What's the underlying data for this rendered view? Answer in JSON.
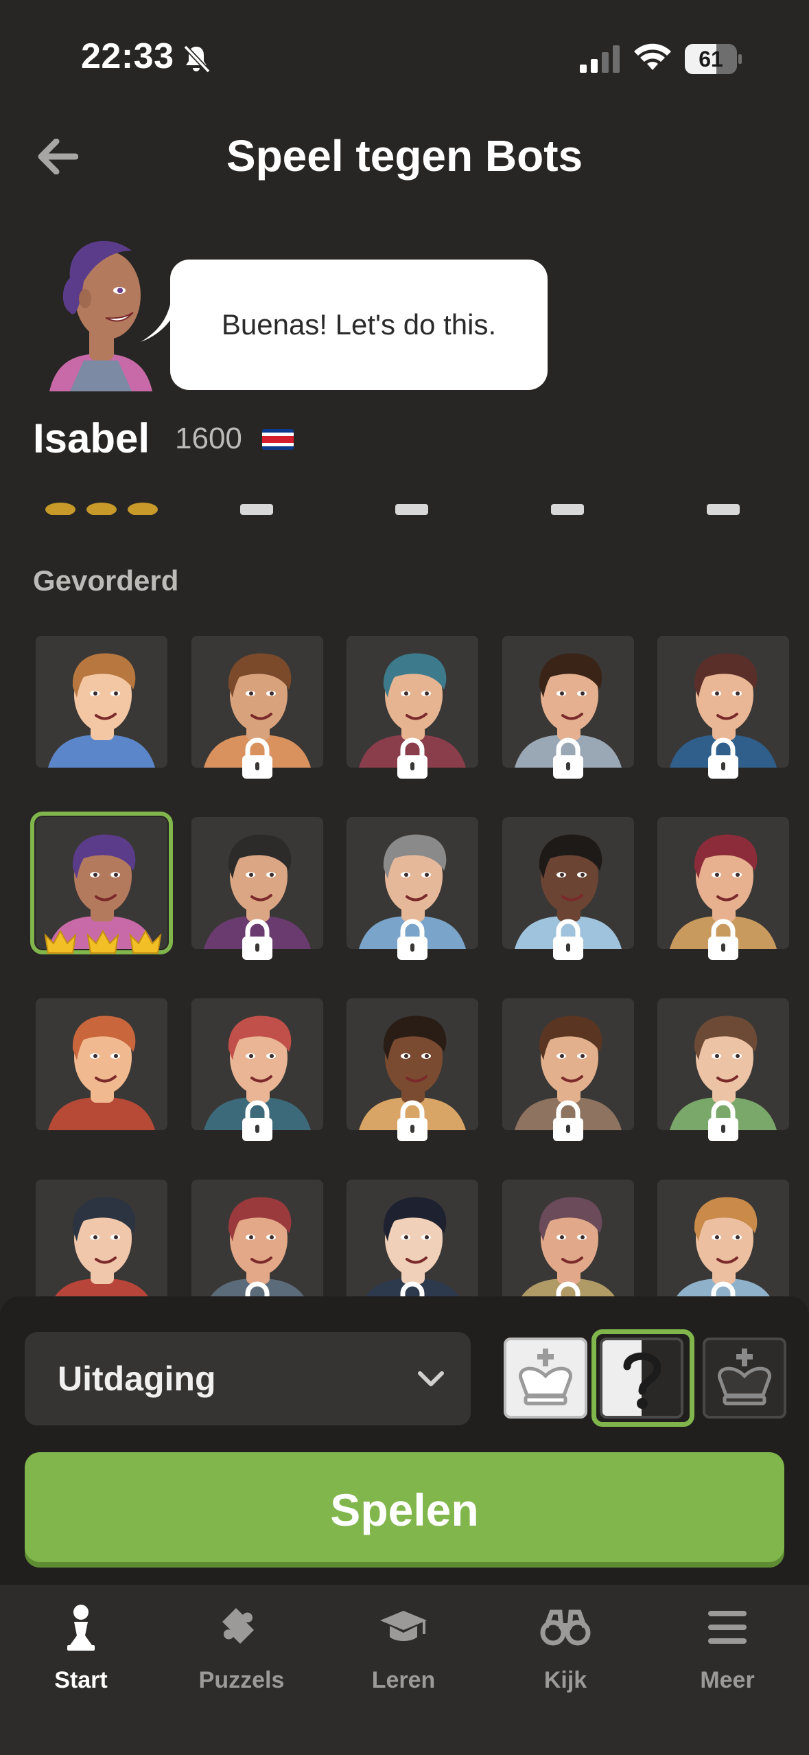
{
  "status_bar": {
    "time": "22:33",
    "battery": "61",
    "battery_level": 0.61
  },
  "header": {
    "title": "Speel tegen Bots"
  },
  "bot": {
    "greeting": "Buenas! Let's do this.",
    "name": "Isabel",
    "rating": "1600",
    "country_flag": "costa-rica-flag"
  },
  "section": {
    "title": "Gevorderd"
  },
  "bots_grid": [
    [
      {
        "locked": false,
        "skin": "#f3c7a4",
        "hair": "#b8773f",
        "shirt": "#5b86c9"
      },
      {
        "locked": true,
        "skin": "#d8a27c",
        "hair": "#7a4a2b",
        "shirt": "#d9925e"
      },
      {
        "locked": true,
        "skin": "#e6b491",
        "hair": "#3d7a8c",
        "shirt": "#8a3e4c"
      },
      {
        "locked": true,
        "skin": "#e4b08f",
        "hair": "#3a2418",
        "shirt": "#9aa7b5"
      },
      {
        "locked": true,
        "skin": "#eab796",
        "hair": "#5a2f2a",
        "shirt": "#2f5f8a"
      }
    ],
    [
      {
        "locked": false,
        "selected": true,
        "skin": "#b47a5e",
        "hair": "#5b3c8a",
        "shirt": "#c96aa8"
      },
      {
        "locked": true,
        "skin": "#dba683",
        "hair": "#2d2a2a",
        "shirt": "#6a3b6f"
      },
      {
        "locked": true,
        "skin": "#e5b89a",
        "hair": "#8a8a8a",
        "shirt": "#7aa4c9"
      },
      {
        "locked": true,
        "skin": "#6b4433",
        "hair": "#1e1a18",
        "shirt": "#9fc3dd"
      },
      {
        "locked": true,
        "skin": "#e7b08f",
        "hair": "#8c2c3a",
        "shirt": "#c99a5e"
      }
    ],
    [
      {
        "locked": false,
        "skin": "#f0b98f",
        "hair": "#c9663c",
        "shirt": "#b64a36"
      },
      {
        "locked": true,
        "skin": "#e9b595",
        "hair": "#c2504a",
        "shirt": "#3d6a7a"
      },
      {
        "locked": true,
        "skin": "#7a4b31",
        "hair": "#2a1d16",
        "shirt": "#d8a566"
      },
      {
        "locked": true,
        "skin": "#e2b08d",
        "hair": "#5a3522",
        "shirt": "#8e7460"
      },
      {
        "locked": true,
        "skin": "#ecc3a5",
        "hair": "#6c4a36",
        "shirt": "#7aa86a"
      }
    ],
    [
      {
        "locked": false,
        "skin": "#f1c7ab",
        "hair": "#2b3440",
        "shirt": "#b8453a"
      },
      {
        "locked": true,
        "skin": "#e3a888",
        "hair": "#9a3a3c",
        "shirt": "#5c6b7a"
      },
      {
        "locked": true,
        "skin": "#f0d0b8",
        "hair": "#1e2230",
        "shirt": "#2d3a4d"
      },
      {
        "locked": true,
        "skin": "#e1a98a",
        "hair": "#6b4a5a",
        "shirt": "#b09a66"
      },
      {
        "locked": true,
        "skin": "#ebbf9f",
        "hair": "#c98a4a",
        "shirt": "#8fb1c9"
      }
    ]
  ],
  "controls": {
    "mode": "Uitdaging",
    "colors": [
      "white-king-icon",
      "random-color-icon",
      "black-king-icon"
    ],
    "selected_color": "random",
    "play": "Spelen"
  },
  "tabs": [
    {
      "label": "Start",
      "icon": "pawn-icon",
      "active": true
    },
    {
      "label": "Puzzels",
      "icon": "puzzle-icon",
      "active": false
    },
    {
      "label": "Leren",
      "icon": "graduation-cap-icon",
      "active": false
    },
    {
      "label": "Kijk",
      "icon": "binoculars-icon",
      "active": false
    },
    {
      "label": "Meer",
      "icon": "menu-icon",
      "active": false
    }
  ],
  "colors": {
    "accent": "#81b64c",
    "background": "#282624",
    "panel": "#211f1d"
  }
}
